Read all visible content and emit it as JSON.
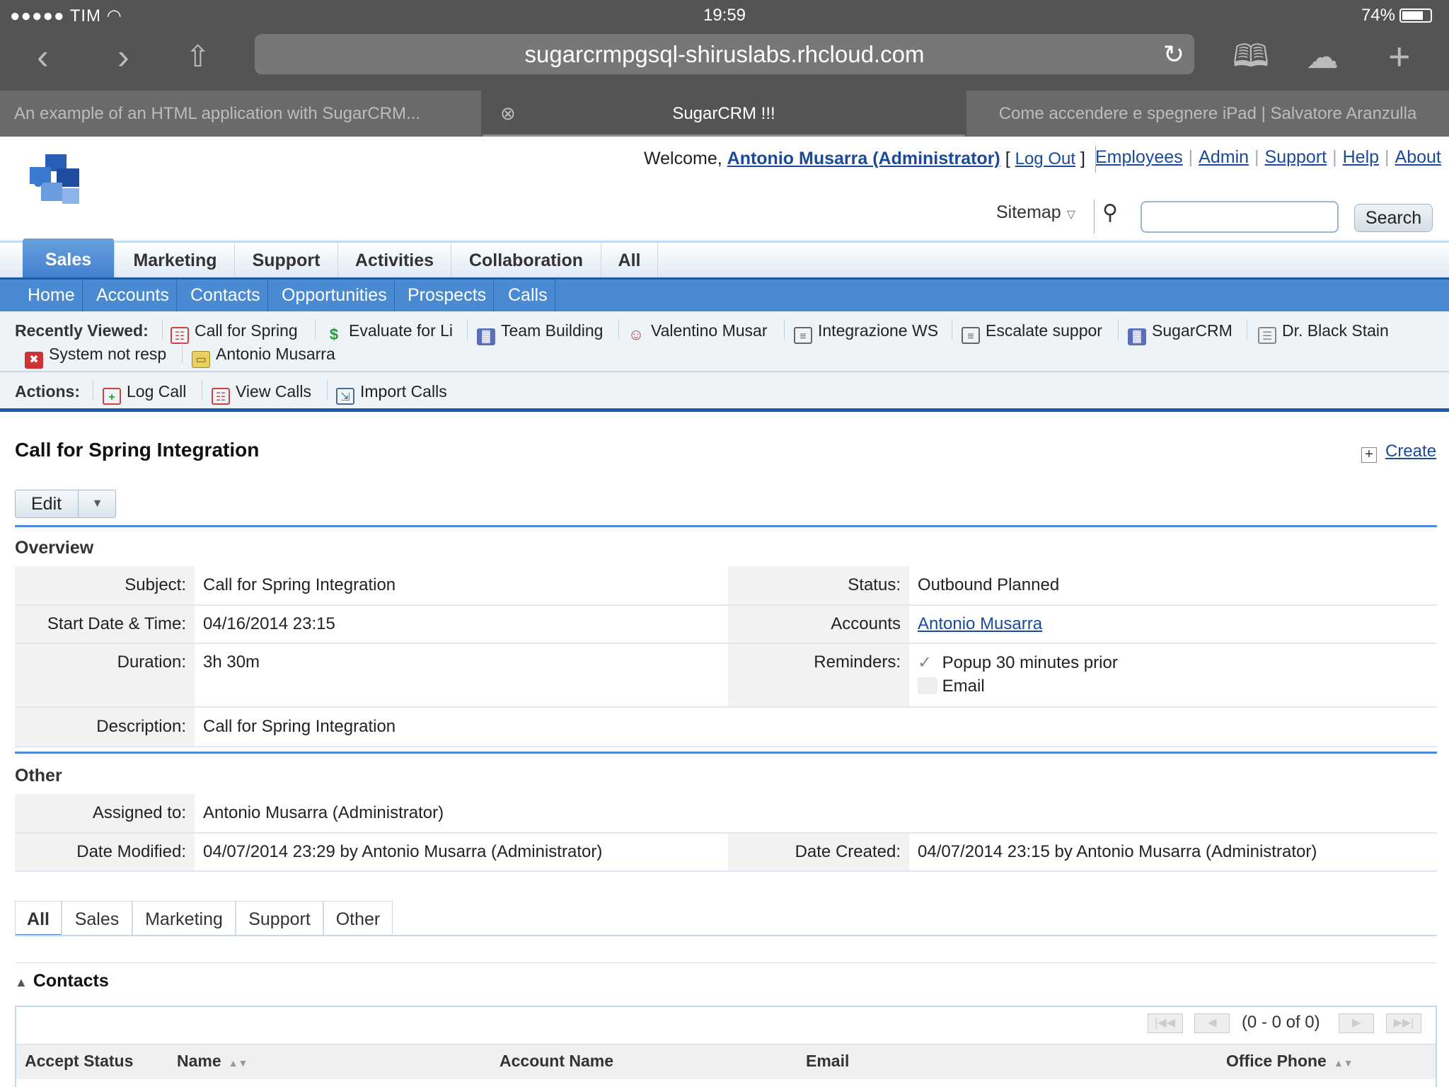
{
  "status_bar": {
    "carrier": "●●●●● TIM",
    "time": "19:59",
    "battery": "74%"
  },
  "browser": {
    "url": "sugarcrmpgsql-shiruslabs.rhcloud.com",
    "tabs": [
      {
        "label": "An example of an HTML application with SugarCRM..."
      },
      {
        "label": "SugarCRM !!!"
      },
      {
        "label": "Come accendere e spegnere iPad | Salvatore Aranzulla"
      }
    ]
  },
  "header": {
    "welcome_prefix": "Welcome,",
    "user": "Antonio Musarra (Administrator)",
    "logout": "Log Out",
    "links": [
      "Employees",
      "Admin",
      "Support",
      "Help",
      "About"
    ],
    "sitemap": "Sitemap",
    "search_button": "Search",
    "search_value": ""
  },
  "module_tabs": [
    "Sales",
    "Marketing",
    "Support",
    "Activities",
    "Collaboration",
    "All"
  ],
  "sub_tabs": [
    "Home",
    "Accounts",
    "Contacts",
    "Opportunities",
    "Prospects",
    "Calls"
  ],
  "recently_viewed": {
    "label": "Recently Viewed:",
    "items": [
      {
        "label": "Call for Spring",
        "icon": "call-icon",
        "color": "#c44"
      },
      {
        "label": "Evaluate for Li",
        "icon": "opportunity-icon",
        "color": "#2a9a3a"
      },
      {
        "label": "Team Building",
        "icon": "project-icon",
        "color": "#5a6fb8"
      },
      {
        "label": "Valentino Musar",
        "icon": "contact-icon",
        "color": "#b84040"
      },
      {
        "label": "Integrazione WS",
        "icon": "document-icon",
        "color": "#666"
      },
      {
        "label": "Escalate suppor",
        "icon": "document-icon",
        "color": "#666"
      },
      {
        "label": "SugarCRM",
        "icon": "project-icon",
        "color": "#5a6fb8"
      },
      {
        "label": "Dr. Black Stain",
        "icon": "note-icon",
        "color": "#888"
      },
      {
        "label": "System not resp",
        "icon": "bug-icon",
        "color": "#c33"
      },
      {
        "label": "Antonio Musarra",
        "icon": "account-icon",
        "color": "#d8b830"
      }
    ]
  },
  "actions": {
    "label": "Actions:",
    "items": [
      {
        "label": "Log Call",
        "icon": "log-call-icon"
      },
      {
        "label": "View Calls",
        "icon": "view-calls-icon"
      },
      {
        "label": "Import Calls",
        "icon": "import-icon"
      }
    ]
  },
  "record": {
    "title": "Call for Spring Integration",
    "create": "Create",
    "edit": "Edit",
    "overview_label": "Overview",
    "subject_label": "Subject:",
    "subject": "Call for Spring Integration",
    "status_label": "Status:",
    "status": "Outbound Planned",
    "start_label": "Start Date & Time:",
    "start": "04/16/2014 23:15",
    "accounts_label": "Accounts",
    "accounts": "Antonio Musarra",
    "duration_label": "Duration:",
    "duration": "3h 30m",
    "reminders_label": "Reminders:",
    "reminder_popup": "Popup 30 minutes prior",
    "reminder_email": "Email",
    "description_label": "Description:",
    "description": "Call for Spring Integration",
    "other_label": "Other",
    "assigned_label": "Assigned to:",
    "assigned": "Antonio Musarra (Administrator)",
    "modified_label": "Date Modified:",
    "modified": "04/07/2014 23:29 by Antonio Musarra (Administrator)",
    "created_label": "Date Created:",
    "created": "04/07/2014 23:15 by Antonio Musarra (Administrator)"
  },
  "subpanel_tabs": [
    "All",
    "Sales",
    "Marketing",
    "Support",
    "Other"
  ],
  "contacts": {
    "title": "Contacts",
    "pager": "(0 - 0 of 0)",
    "columns": [
      "Accept Status",
      "Name",
      "Account Name",
      "Email",
      "Office Phone"
    ]
  }
}
